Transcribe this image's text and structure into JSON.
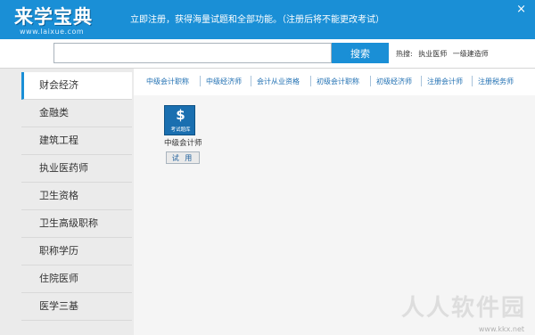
{
  "header": {
    "logo_text": "来学宝典",
    "logo_url": "www.laixue.com",
    "notice": "立即注册，获得海量试题和全部功能。（注册后将不能更改考试）",
    "close_label": "×"
  },
  "search": {
    "value": "",
    "placeholder": "",
    "button_label": "搜索"
  },
  "hot": {
    "label": "热搜:",
    "terms": [
      "执业医师",
      "一级建造师"
    ]
  },
  "sidebar": {
    "items": [
      {
        "label": "财会经济"
      },
      {
        "label": "金融类"
      },
      {
        "label": "建筑工程"
      },
      {
        "label": "执业医药师"
      },
      {
        "label": "卫生资格"
      },
      {
        "label": "卫生高级职称"
      },
      {
        "label": "职称学历"
      },
      {
        "label": "住院医师"
      },
      {
        "label": "医学三基"
      }
    ],
    "active_index": 0
  },
  "tabs": [
    {
      "label": "中级会计职称"
    },
    {
      "label": "中级经济师"
    },
    {
      "label": "会计从业资格"
    },
    {
      "label": "初级会计职称"
    },
    {
      "label": "初级经济师"
    },
    {
      "label": "注册会计师"
    },
    {
      "label": "注册税务师"
    }
  ],
  "card": {
    "icon_symbol": "$",
    "icon_label": "考试题库",
    "title": "中级会计师",
    "try_label": "试 用"
  },
  "watermark": {
    "text": "人人软件园",
    "url": "www.kkx.net"
  },
  "colors": {
    "brand": "#1a8fd6",
    "tab_text": "#1f6fb2",
    "sidebar_bg": "#ebebeb",
    "content_bg": "#f5f5f5"
  }
}
